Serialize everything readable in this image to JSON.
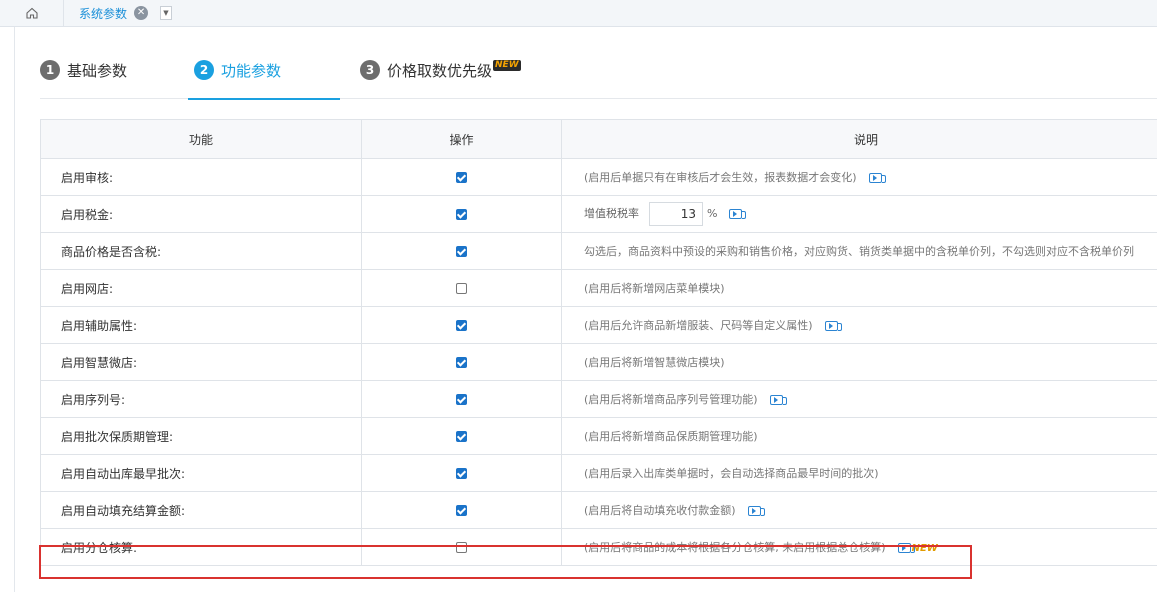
{
  "tabs": {
    "active_tab": "系统参数",
    "close": "✕",
    "dropdown": "▼"
  },
  "steps": [
    {
      "num": "1",
      "label": "基础参数"
    },
    {
      "num": "2",
      "label": "功能参数"
    },
    {
      "num": "3",
      "label": "价格取数优先级",
      "badge": "NEW"
    }
  ],
  "table": {
    "headers": [
      "功能",
      "操作",
      "说明"
    ],
    "rows": [
      {
        "func": "启用审核:",
        "checked": true,
        "desc": "(启用后单据只有在审核后才会生效，报表数据才会变化)",
        "video": true
      },
      {
        "func": "启用税金:",
        "checked": true,
        "tax_label": "增值税税率",
        "tax_value": "13",
        "tax_unit": "%",
        "video": true
      },
      {
        "func": "商品价格是否含税:",
        "checked": true,
        "desc": "勾选后，商品资料中预设的采购和销售价格，对应购货、销货类单据中的含税单价列，不勾选则对应不含税单价列",
        "video": false
      },
      {
        "func": "启用网店:",
        "checked": false,
        "desc": "(启用后将新增网店菜单模块)",
        "video": false
      },
      {
        "func": "启用辅助属性:",
        "checked": true,
        "desc": "(启用后允许商品新增服装、尺码等自定义属性)",
        "video": true
      },
      {
        "func": "启用智慧微店:",
        "checked": true,
        "desc": "(启用后将新增智慧微店模块)",
        "video": false
      },
      {
        "func": "启用序列号:",
        "checked": true,
        "desc": "(启用后将新增商品序列号管理功能)",
        "video": true
      },
      {
        "func": "启用批次保质期管理:",
        "checked": true,
        "desc": "(启用后将新增商品保质期管理功能)",
        "video": false
      },
      {
        "func": "启用自动出库最早批次:",
        "checked": true,
        "desc": "(启用后录入出库类单据时，会自动选择商品最早时间的批次)",
        "video": false
      },
      {
        "func": "启用自动填充结算金额:",
        "checked": true,
        "desc": "(启用后将自动填充收付款金额)",
        "video": true
      },
      {
        "func": "启用分仓核算:",
        "checked": false,
        "desc": "(启用后将商品的成本将根据各分仓核算, 未启用根据总仓核算)",
        "video": true,
        "badge": "NEW"
      }
    ]
  },
  "colors": {
    "accent": "#1aa0e0",
    "checkbox": "#1a73c9",
    "highlight": "#d9322f"
  }
}
